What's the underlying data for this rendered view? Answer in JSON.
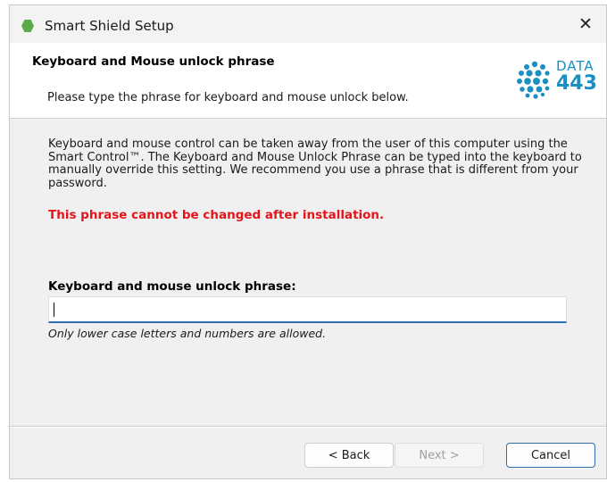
{
  "window": {
    "title": "Smart Shield Setup",
    "close_glyph": "✕"
  },
  "header": {
    "title": "Keyboard and Mouse unlock phrase",
    "subtitle": "Please type the phrase for keyboard and mouse unlock below.",
    "logo": {
      "word": "DATA",
      "number": "443",
      "color": "#1a8fc3"
    }
  },
  "body": {
    "description": "Keyboard and mouse control can be taken away from the user of this computer using the Smart Control™. The Keyboard and Mouse Unlock Phrase can be typed into the keyboard to manually override this setting. We recommend you use a phrase that is different from your password.",
    "warning": "This phrase cannot be changed after installation.",
    "warning_color": "#e4151b"
  },
  "field": {
    "label": "Keyboard and mouse unlock phrase:",
    "value": "",
    "hint": "Only lower case letters and numbers are allowed."
  },
  "buttons": {
    "back": "< Back",
    "next": "Next >",
    "cancel": "Cancel"
  },
  "icons": {
    "app": "smart-shield-app-icon",
    "close": "close-icon",
    "logo": "data443-logo"
  }
}
